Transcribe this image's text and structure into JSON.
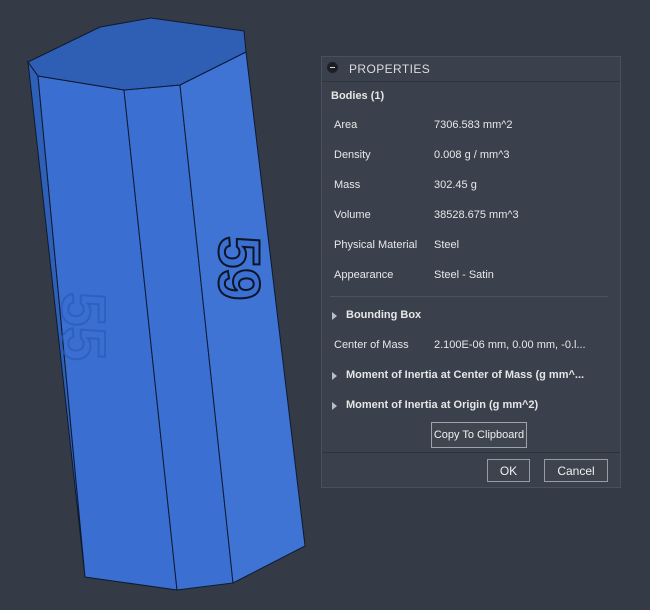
{
  "properties": {
    "title": "PROPERTIES",
    "bodies_header": "Bodies (1)",
    "rows": [
      {
        "label": "Area",
        "value": "7306.583 mm^2"
      },
      {
        "label": "Density",
        "value": "0.008 g / mm^3"
      },
      {
        "label": "Mass",
        "value": "302.45 g"
      },
      {
        "label": "Volume",
        "value": "38528.675 mm^3"
      },
      {
        "label": "Physical Material",
        "value": "Steel"
      },
      {
        "label": "Appearance",
        "value": "Steel - Satin"
      }
    ],
    "bounding_box_label": "Bounding Box",
    "center_of_mass": {
      "label": "Center of Mass",
      "value": "2.100E-06 mm, 0.00 mm, -0.l..."
    },
    "moment_center_label": "Moment of Inertia at Center of Mass   (g mm^...",
    "moment_origin_label": "Moment of Inertia at Origin   (g mm^2)",
    "copy_button": "Copy To Clipboard",
    "ok_button": "OK",
    "cancel_button": "Cancel"
  },
  "model": {
    "engraved_text": "59",
    "back_engraved_text": "55",
    "body_color": "#3b6fc9",
    "top_color": "#2f5fb5"
  },
  "colors": {
    "background": "#343b47",
    "panel": "#3a414c"
  }
}
